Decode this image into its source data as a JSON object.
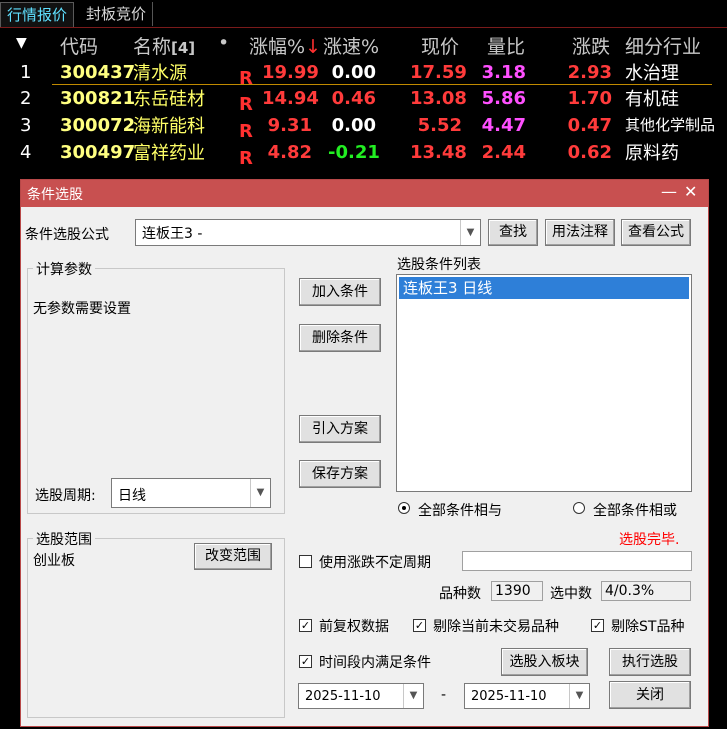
{
  "tabs": [
    {
      "label": "行情报价",
      "active": true
    },
    {
      "label": "封板竞价",
      "active": false
    }
  ],
  "table": {
    "headers": {
      "code": "代码",
      "name": "名称",
      "name_count": "[4]",
      "dot": "•",
      "change_pct": "涨幅%",
      "sort_arrow": "↓",
      "speed_pct": "涨速%",
      "price": "现价",
      "volume_ratio": "量比",
      "change": "涨跌",
      "industry": "细分行业"
    },
    "rows": [
      {
        "idx": "1",
        "code": "300437",
        "name": "清水源",
        "tag": "R",
        "change_pct": "19.99",
        "speed": "0.00",
        "price": "17.59",
        "vr": "3.18",
        "change": "2.93",
        "industry": "水治理"
      },
      {
        "idx": "2",
        "code": "300821",
        "name": "东岳硅材",
        "tag": "R",
        "change_pct": "14.94",
        "speed": "0.46",
        "price": "13.08",
        "vr": "5.86",
        "change": "1.70",
        "industry": "有机硅"
      },
      {
        "idx": "3",
        "code": "300072",
        "name": "海新能科",
        "tag": "R",
        "change_pct": "9.31",
        "speed": "0.00",
        "price": "5.52",
        "vr": "4.47",
        "change": "0.47",
        "industry": "其他化学制品"
      },
      {
        "idx": "4",
        "code": "300497",
        "name": "富祥药业",
        "tag": "R",
        "change_pct": "4.82",
        "speed": "-0.21",
        "price": "13.48",
        "vr": "2.44",
        "change": "0.62",
        "industry": "原料药"
      }
    ]
  },
  "dialog": {
    "title": "条件选股",
    "minimize": "—",
    "close": "✕",
    "formula_label": "条件选股公式",
    "formula_value": "连板王3  -",
    "find_button": "查找",
    "usage_button": "用法注释",
    "view_formula_button": "查看公式",
    "params_group": "计算参数",
    "no_params": "无参数需要设置",
    "period_label": "选股周期:",
    "period_value": "日线",
    "add_condition": "加入条件",
    "delete_condition": "删除条件",
    "import_plan": "引入方案",
    "save_plan": "保存方案",
    "condition_list_label": "选股条件列表",
    "condition_items": [
      "连板王3  日线"
    ],
    "radio_and": "全部条件相与",
    "radio_or": "全部条件相或",
    "status": "选股完毕.",
    "range_group": "选股范围",
    "range_value": "创业板",
    "change_range": "改变范围",
    "use_var_period": "使用涨跌不定周期",
    "count_label": "品种数",
    "count_value": "1390",
    "selected_label": "选中数",
    "selected_value": "4/0.3%",
    "adj_data": "前复权数据",
    "exclude_untraded": "剔除当前未交易品种",
    "exclude_st": "剔除ST品种",
    "time_condition": "时间段内满足条件",
    "to_block_button": "选股入板块",
    "execute_button": "执行选股",
    "date_from": "2025-11-10",
    "date_sep": "-",
    "date_to": "2025-11-10",
    "close_button": "关闭",
    "check_mark": "✓"
  },
  "colors": {
    "title_bar": "#c85050",
    "selection": "#2e7fd8",
    "status_red": "#ff0000"
  }
}
